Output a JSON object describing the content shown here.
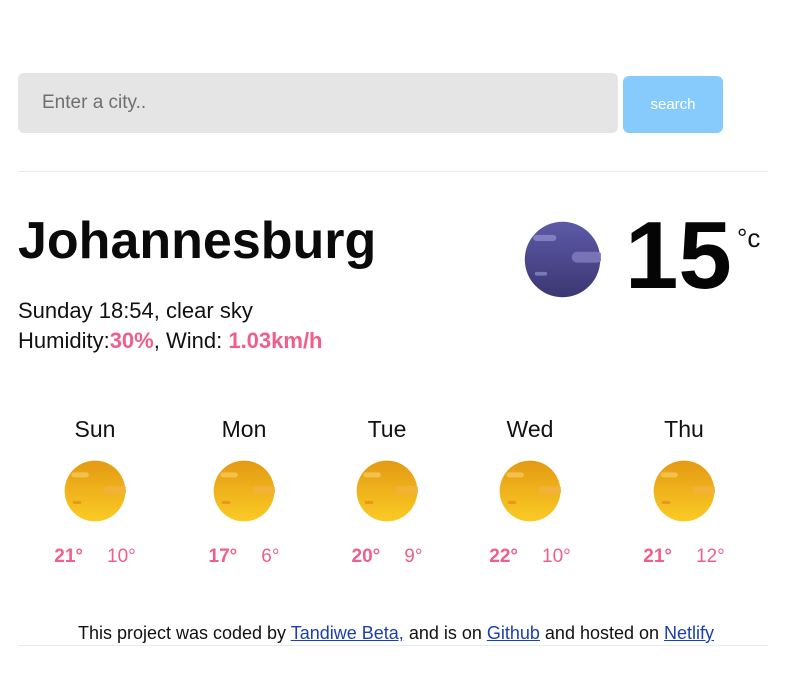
{
  "search": {
    "placeholder": "Enter a city..",
    "value": "",
    "button_label": "search"
  },
  "current": {
    "city": "Johannesburg",
    "datetime": "Sunday 18:54",
    "description": "clear sky",
    "humidity_label": "Humidity:",
    "humidity": "30%",
    "wind_label": "Wind: ",
    "wind": "1.03km/h",
    "temperature": "15",
    "unit": "°c",
    "icon": "moon-clear-night-icon"
  },
  "forecast": [
    {
      "day": "Sun",
      "max": "21°",
      "min": "10°",
      "icon": "sun-clear-icon"
    },
    {
      "day": "Mon",
      "max": "17°",
      "min": "6°",
      "icon": "sun-clear-icon"
    },
    {
      "day": "Tue",
      "max": "20°",
      "min": "9°",
      "icon": "sun-clear-icon"
    },
    {
      "day": "Wed",
      "max": "22°",
      "min": "10°",
      "icon": "sun-clear-icon"
    },
    {
      "day": "Thu",
      "max": "21°",
      "min": "12°",
      "icon": "sun-clear-icon"
    }
  ],
  "footer": {
    "text1": "This project was coded by ",
    "author": "Tandiwe Beta,",
    "text2": " and is on ",
    "github": "Github",
    "text3": " and hosted on ",
    "netlify": "Netlify"
  },
  "colors": {
    "accent": "#ef5f8a",
    "search_button": "#87cafc",
    "input_bg": "#e5e5e5",
    "link": "#1a3fb0",
    "moon": "#4e4a8c",
    "sun": "#f5b519"
  }
}
